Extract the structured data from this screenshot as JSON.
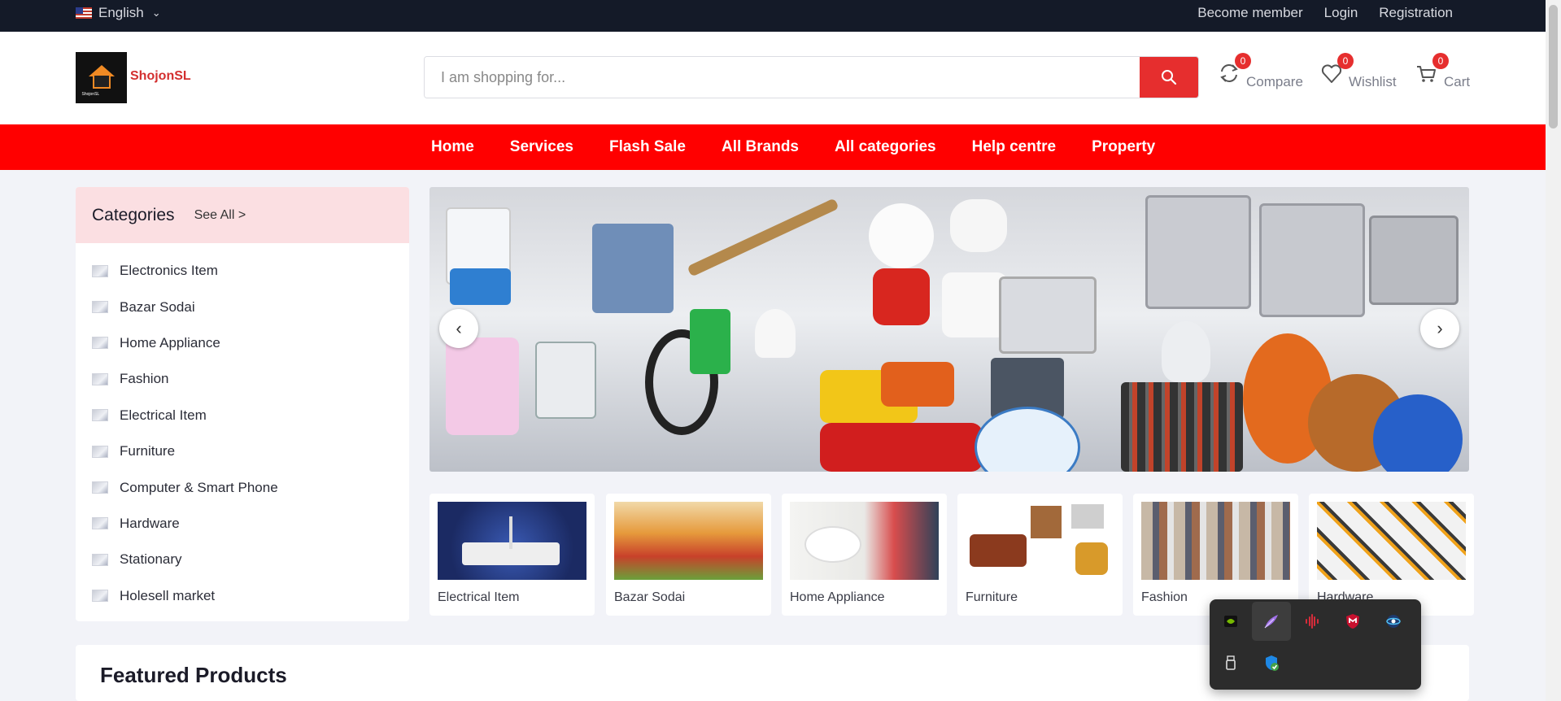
{
  "topbar": {
    "language": "English",
    "links": [
      "Become member",
      "Login",
      "Registration"
    ]
  },
  "header": {
    "brand": "ShojonSL",
    "logo_caption": "ShojonSL",
    "search_placeholder": "I am shopping for...",
    "compare": {
      "label": "Compare",
      "count": "0"
    },
    "wishlist": {
      "label": "Wishlist",
      "count": "0"
    },
    "cart": {
      "label": "Cart",
      "count": "0"
    }
  },
  "nav": [
    "Home",
    "Services",
    "Flash Sale",
    "All Brands",
    "All categories",
    "Help centre",
    "Property"
  ],
  "categories": {
    "title": "Categories",
    "see_all": "See All >",
    "items": [
      "Electronics Item",
      "Bazar Sodai",
      "Home Appliance",
      "Fashion",
      "Electrical Item",
      "Furniture",
      "Computer & Smart Phone",
      "Hardware",
      "Stationary",
      "Holesell market"
    ]
  },
  "slider": {
    "prev_icon": "chevron-left-icon",
    "next_icon": "chevron-right-icon"
  },
  "category_cards": [
    "Electrical Item",
    "Bazar Sodai",
    "Home Appliance",
    "Furniture",
    "Fashion",
    "Hardware"
  ],
  "featured": {
    "title": "Featured Products"
  },
  "colors": {
    "accent": "#ff0000",
    "topbar": "#141a28",
    "badge": "#e62e2e"
  },
  "tray_icons": [
    "nvidia-icon",
    "feather-app-icon",
    "audio-app-icon",
    "mcafee-icon",
    "network-app-icon",
    "usb-drive-icon",
    "windows-security-icon"
  ]
}
